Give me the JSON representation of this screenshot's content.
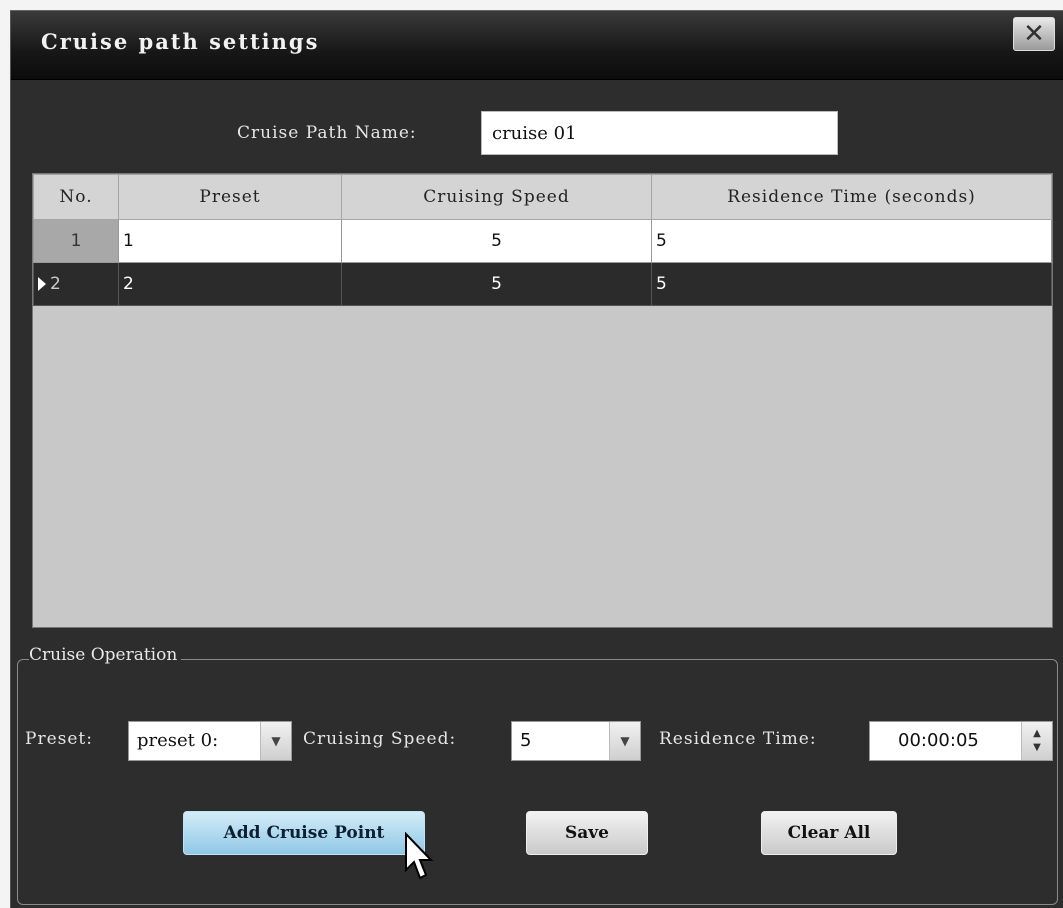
{
  "window": {
    "title": "Cruise path settings",
    "close_glyph": "✕"
  },
  "path_name": {
    "label": "Cruise Path Name:",
    "value": "cruise 01"
  },
  "table": {
    "columns": [
      "No.",
      "Preset",
      "Cruising Speed",
      "Residence Time (seconds)"
    ],
    "rows": [
      {
        "no": "1",
        "preset": "1",
        "speed": "5",
        "time": "5",
        "selected": false
      },
      {
        "no": "2",
        "preset": "2",
        "speed": "5",
        "time": "5",
        "selected": true
      }
    ]
  },
  "operation": {
    "legend": "Cruise Operation",
    "preset_label": "Preset:",
    "preset_value": "preset 0:",
    "speed_label": "Cruising Speed:",
    "speed_value": "5",
    "time_label": "Residence Time:",
    "time_value": "00:00:05",
    "dropdown_glyph": "▼",
    "spin_up": "▲",
    "spin_down": "▼"
  },
  "buttons": {
    "add": "Add Cruise Point",
    "save": "Save",
    "clear": "Clear All"
  },
  "colors": {
    "window_bg": "#2d2d2d",
    "primary_button": "#8fc8e6",
    "selected_row": "#2b2b2b"
  },
  "icons": {
    "close": "close-icon",
    "row_indicator": "row-pointer-icon",
    "cursor": "mouse-cursor-icon"
  }
}
